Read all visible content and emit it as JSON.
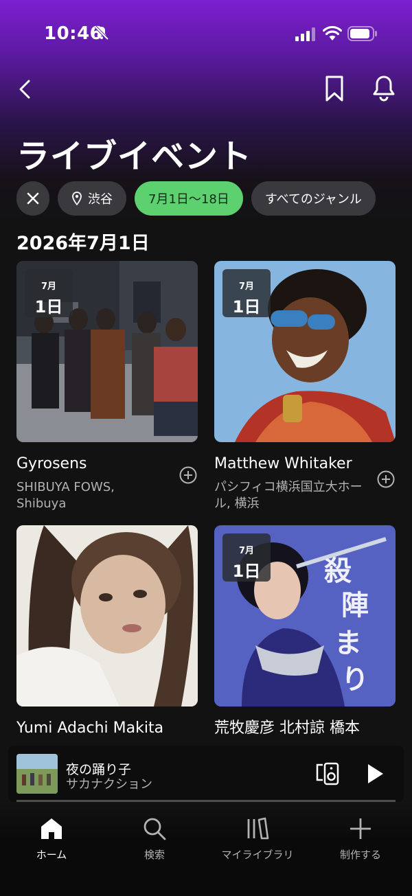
{
  "status": {
    "time": "10:46"
  },
  "header": {
    "title": "ライブイベント"
  },
  "filters": {
    "location": "渋谷",
    "dates": "7月1日〜18日",
    "genre": "すべてのジャンル"
  },
  "section_date": "2026年7月1日",
  "events": [
    {
      "badge_month": "7月",
      "badge_day": "1日",
      "title": "Gyrosens",
      "venue": "SHIBUYA FOWS, Shibuya"
    },
    {
      "badge_month": "7月",
      "badge_day": "1日",
      "title": "Matthew Whitaker",
      "venue": "パシフィコ横浜国立大ホール, 横浜"
    },
    {
      "title": "Yumi Adachi Makita"
    },
    {
      "badge_month": "7月",
      "badge_day": "1日",
      "title": "荒牧慶彦 北村諒 橋本"
    }
  ],
  "now_playing": {
    "title": "夜の踊り子",
    "artist": "サカナクション"
  },
  "tabs": [
    {
      "label": "ホーム"
    },
    {
      "label": "検索"
    },
    {
      "label": "マイライブラリ"
    },
    {
      "label": "制作する"
    }
  ],
  "colors": {
    "accent_green": "#5dd170",
    "header_purple": "#7d1fd1"
  }
}
